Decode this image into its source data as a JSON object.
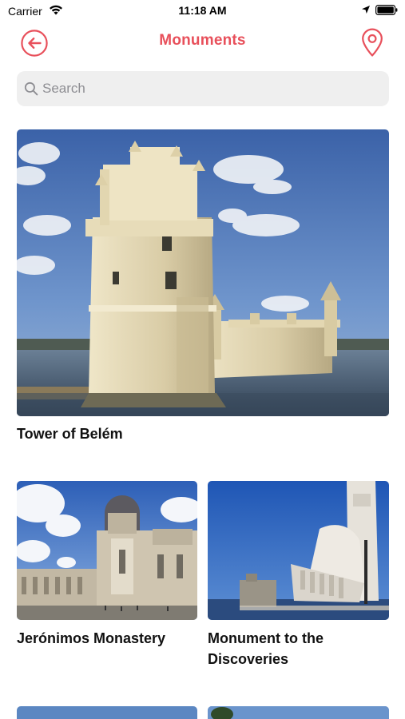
{
  "status_bar": {
    "carrier": "Carrier",
    "time": "11:18 AM"
  },
  "nav": {
    "title": "Monuments",
    "back_icon": "arrow-left-circle-icon",
    "right_icon": "map-pin-icon"
  },
  "search": {
    "placeholder": "Search",
    "value": ""
  },
  "colors": {
    "accent": "#e8505b",
    "search_background": "#efefef"
  },
  "monuments": [
    {
      "title": "Tower of Belém"
    },
    {
      "title": "Jerónimos Monastery"
    },
    {
      "title": "Monument to the Discoveries"
    }
  ]
}
